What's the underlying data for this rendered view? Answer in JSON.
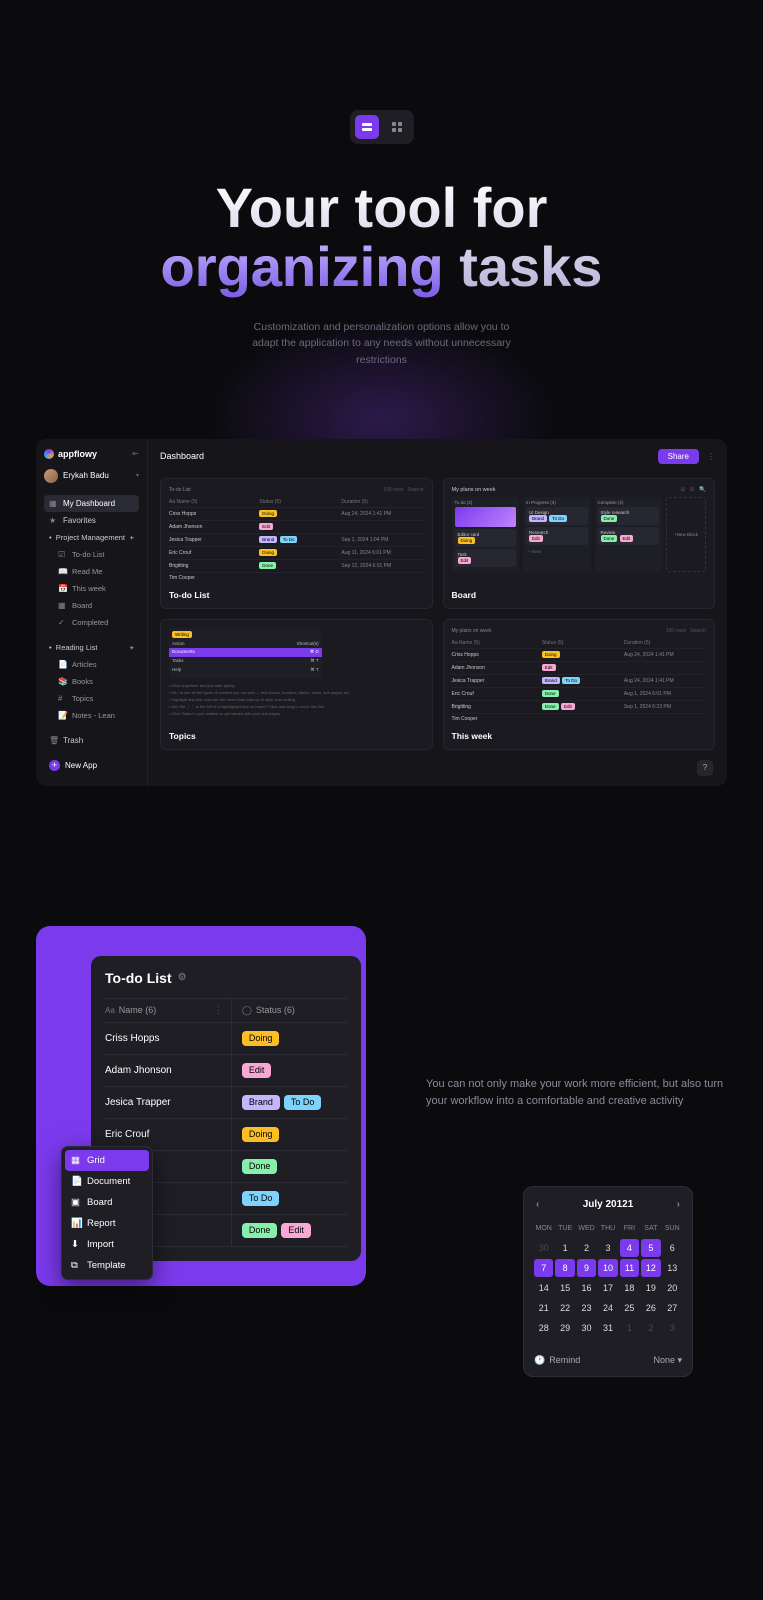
{
  "hero": {
    "title_line1": "Your tool for",
    "title_line2a": "organizing",
    "title_line2b": " tasks",
    "subtitle": "Customization and personalization options allow you to adapt the application to any needs without unnecessary restrictions"
  },
  "app": {
    "brand": "appflowy",
    "user": "Erykah Badu",
    "nav": {
      "dashboard": "My Dashboard",
      "favorites": "Favorites",
      "sections": [
        {
          "title": "Project Management",
          "items": [
            "To-do List",
            "Read Me",
            "This week",
            "Board",
            "Completed"
          ]
        },
        {
          "title": "Reading List",
          "items": [
            "Articles",
            "Books",
            "Topics",
            "Notes - Lean"
          ]
        }
      ],
      "trash": "Trash",
      "new_app": "New App"
    },
    "header": {
      "title": "Dashboard",
      "share": "Share"
    },
    "cards": {
      "todo": {
        "title": "To-do List",
        "header": "To-do List",
        "meta_right": [
          "100 rows",
          "Search"
        ],
        "cols": [
          "Aa  Name (5)",
          "Status (5)",
          "Duration (5)"
        ],
        "rows": [
          {
            "name": "Criss Hopps",
            "status": [
              "Doing"
            ],
            "date": "Aug 24, 2024 1:41 PM"
          },
          {
            "name": "Adam Jhonson",
            "status": [
              "Edit"
            ],
            "date": ""
          },
          {
            "name": "Jesica Trapper",
            "status": [
              "Brand",
              "To Do"
            ],
            "date": "Sep 1, 2024 1:04 PM"
          },
          {
            "name": "Eric Crouf",
            "status": [
              "Doing"
            ],
            "date": "Aug 11, 2024 6:01 PM"
          },
          {
            "name": "Brigitting",
            "status": [
              "Done"
            ],
            "date": "Sep 12, 2024 6:01 PM"
          },
          {
            "name": "Tim Cooper",
            "status": [],
            "date": ""
          }
        ]
      },
      "board": {
        "title": "Board",
        "header": "My plans on week",
        "cols": [
          {
            "h": "To do (2)"
          },
          {
            "h": "In Progress (3)"
          },
          {
            "h": "Complete (2)"
          }
        ],
        "new_block": "New Block"
      },
      "topics": {
        "title": "Topics",
        "tag": "Writing",
        "rows": [
          {
            "label": "Action",
            "kbd": "Shortcut(s)"
          },
          {
            "label": "Documents",
            "kbd": "⌘ D",
            "sel": true
          },
          {
            "label": "Tasks",
            "kbd": "⌘ T"
          },
          {
            "label": "Help",
            "kbd": "⌘ T"
          }
        ],
        "bullets": [
          "Click anywhere and just start typing",
          "Hit / to see all the types of content you can add — text blocks, headers, tables, video, sub pages, etc.",
          "Highlight any text, and use the menu that pops up to style your writing",
          "See the ⋮⋮ to the left of a hightlighted line on hover? Click and drag to move this line",
          "Click Tasks in your sidebar to get started with your sub pages"
        ]
      },
      "thisweek": {
        "title": "This week",
        "header": "My plans on week",
        "cols": [
          "Aa  Name (5)",
          "Status (5)",
          "Duration (5)"
        ],
        "rows": [
          {
            "name": "Criss Hopps",
            "status": [
              "Doing"
            ],
            "date": "Aug 24, 2024 1:41 PM"
          },
          {
            "name": "Adam Jhonson",
            "status": [
              "Edit"
            ],
            "date": ""
          },
          {
            "name": "Jesica Trapper",
            "status": [
              "Brand",
              "To Do"
            ],
            "date": "Aug 24, 2024 1:41 PM"
          },
          {
            "name": "Eric Crouf",
            "status": [
              "Done"
            ],
            "date": "Aug 1, 2024 6:01 PM"
          },
          {
            "name": "Brigitting",
            "status": [
              "Done",
              "Edit"
            ],
            "date": "Sep 1, 2024 6:23 PM"
          },
          {
            "name": "Tim Cooper",
            "status": [],
            "date": ""
          }
        ]
      }
    }
  },
  "section2": {
    "todo": {
      "title": "To-do List",
      "name_col": "Name (6)",
      "status_col": "Status (6)",
      "rows": [
        {
          "name": "Criss Hopps",
          "status": [
            "Doing"
          ]
        },
        {
          "name": "Adam Jhonson",
          "status": [
            "Edit"
          ]
        },
        {
          "name": "Jesica Trapper",
          "status": [
            "Brand",
            "To Do"
          ]
        },
        {
          "name": "Eric Crouf",
          "status": [
            "Doing"
          ]
        },
        {
          "name": "",
          "status": [
            "Done"
          ]
        },
        {
          "name": "",
          "status": [
            "To Do"
          ]
        },
        {
          "name": "",
          "status": [
            "Done",
            "Edit"
          ]
        }
      ]
    },
    "ctx": [
      "Grid",
      "Document",
      "Board",
      "Report",
      "Import",
      "Template"
    ],
    "desc": "You can not only make your work more efficient, but also turn your workflow into a comfortable and creative activity"
  },
  "calendar": {
    "month": "July 20121",
    "dow": [
      "MON",
      "TUE",
      "WED",
      "THU",
      "FRI",
      "SAT",
      "SUN"
    ],
    "days": [
      {
        "d": 30,
        "dim": true
      },
      {
        "d": 1
      },
      {
        "d": 2
      },
      {
        "d": 3
      },
      {
        "d": 4,
        "sel": true
      },
      {
        "d": 5,
        "sel": true
      },
      {
        "d": 6
      },
      {
        "d": 7,
        "sel": true
      },
      {
        "d": 8,
        "sel": true
      },
      {
        "d": 9,
        "sel": true
      },
      {
        "d": 10,
        "sel": true
      },
      {
        "d": 11,
        "sel": true
      },
      {
        "d": 12,
        "sel": true
      },
      {
        "d": 13
      },
      {
        "d": 14
      },
      {
        "d": 15
      },
      {
        "d": 16
      },
      {
        "d": 17
      },
      {
        "d": 18
      },
      {
        "d": 19
      },
      {
        "d": 20
      },
      {
        "d": 21
      },
      {
        "d": 22
      },
      {
        "d": 23
      },
      {
        "d": 24
      },
      {
        "d": 25
      },
      {
        "d": 26
      },
      {
        "d": 27
      },
      {
        "d": 28
      },
      {
        "d": 29
      },
      {
        "d": 30
      },
      {
        "d": 31
      },
      {
        "d": 1,
        "dim": true
      },
      {
        "d": 2,
        "dim": true
      },
      {
        "d": 3,
        "dim": true
      }
    ],
    "remind": "Remind",
    "none": "None"
  },
  "tag_classes": {
    "Doing": "t-doing",
    "Edit": "t-edit",
    "Brand": "t-brand",
    "To Do": "t-todo",
    "Done": "t-done"
  }
}
